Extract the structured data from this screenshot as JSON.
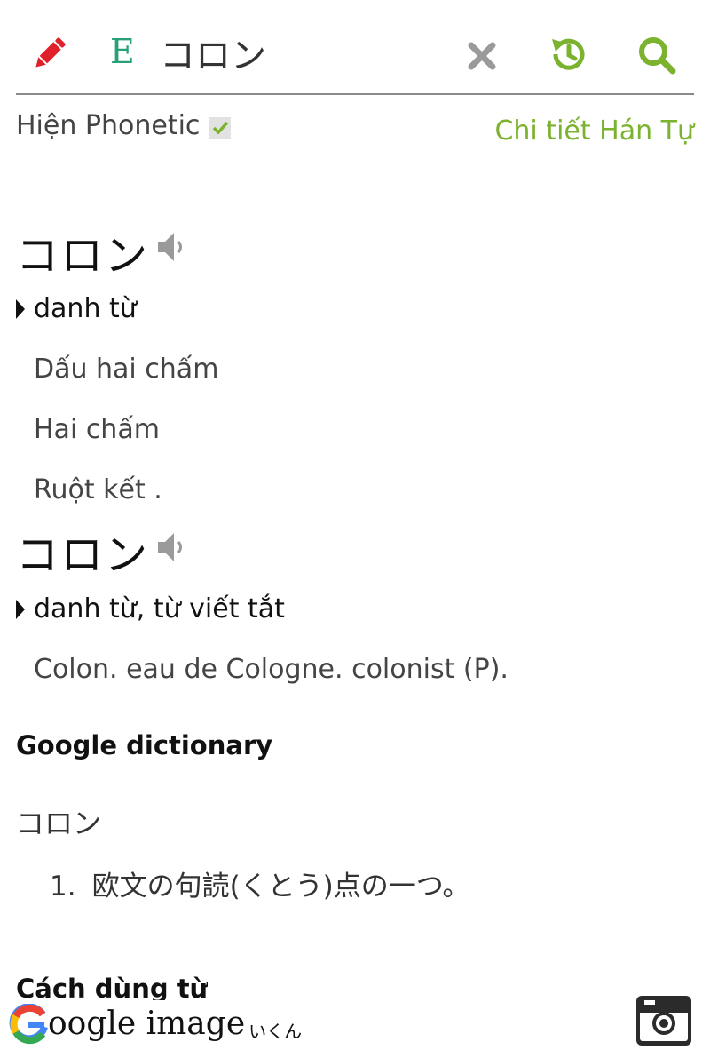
{
  "header": {
    "edit_icon": "pencil-icon",
    "lang_badge": "E",
    "search_value": "コロン",
    "clear_icon": "close-icon",
    "history_icon": "history-icon",
    "search_icon": "search-icon"
  },
  "options": {
    "phonetic_label": "Hiện Phonetic",
    "phonetic_checked": true,
    "kanji_detail_link": "Chi tiết Hán Tự"
  },
  "entries": [
    {
      "word": "コロン",
      "pos": "danh từ",
      "meanings": [
        "Dấu hai chấm",
        "Hai chấm",
        "Ruột kết ."
      ]
    },
    {
      "word": "コロン",
      "pos": "danh từ, từ viết tắt",
      "meanings": [
        "Colon. eau de Cologne. colonist (P)."
      ]
    }
  ],
  "google_dictionary": {
    "title": "Google dictionary",
    "word": "コロン",
    "definitions": [
      {
        "num": "1.",
        "text": "欧文の句読(くとう)点の一つ。"
      }
    ]
  },
  "usage": {
    "title": "Cách dùng từ"
  },
  "google_image": {
    "text": "oogle image",
    "sub": "いくん"
  },
  "colors": {
    "accent_green": "#7cb32e",
    "edit_red": "#e0202a",
    "badge_green": "#2aa079",
    "icon_gray": "#9a9a9a"
  }
}
